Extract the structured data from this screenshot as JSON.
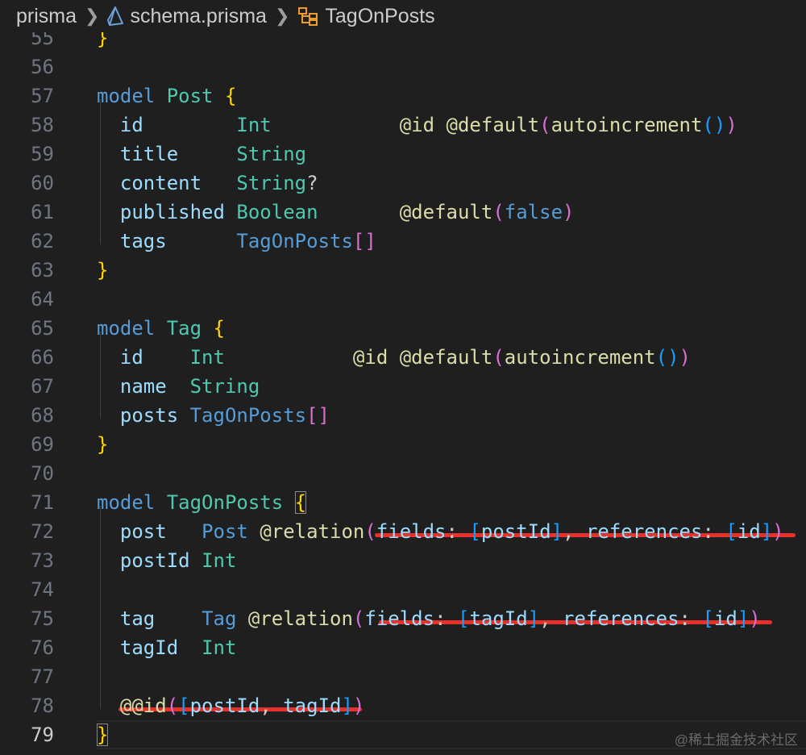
{
  "breadcrumb": {
    "folder": "prisma",
    "file": "schema.prisma",
    "symbol": "TagOnPosts"
  },
  "lines": [
    {
      "num": "55",
      "tokens": [
        {
          "t": "}",
          "c": "b1"
        }
      ]
    },
    {
      "num": "56",
      "tokens": []
    },
    {
      "num": "57",
      "tokens": [
        {
          "t": "model",
          "c": "kw"
        },
        {
          "t": " "
        },
        {
          "t": "Post",
          "c": "mn"
        },
        {
          "t": " "
        },
        {
          "t": "{",
          "c": "b1"
        }
      ]
    },
    {
      "num": "58",
      "tokens": [
        {
          "t": "  "
        },
        {
          "t": "id",
          "c": "fd"
        },
        {
          "t": "        "
        },
        {
          "t": "Int",
          "c": "ty"
        },
        {
          "t": "           "
        },
        {
          "t": "@id",
          "c": "at"
        },
        {
          "t": " "
        },
        {
          "t": "@default",
          "c": "at"
        },
        {
          "t": "(",
          "c": "b2"
        },
        {
          "t": "autoincrement",
          "c": "at"
        },
        {
          "t": "()",
          "c": "b3"
        },
        {
          "t": ")",
          "c": "b2"
        }
      ]
    },
    {
      "num": "59",
      "tokens": [
        {
          "t": "  "
        },
        {
          "t": "title",
          "c": "fd"
        },
        {
          "t": "     "
        },
        {
          "t": "String",
          "c": "ty"
        }
      ]
    },
    {
      "num": "60",
      "tokens": [
        {
          "t": "  "
        },
        {
          "t": "content",
          "c": "fd"
        },
        {
          "t": "   "
        },
        {
          "t": "String",
          "c": "ty"
        },
        {
          "t": "?"
        }
      ]
    },
    {
      "num": "61",
      "tokens": [
        {
          "t": "  "
        },
        {
          "t": "published",
          "c": "fd"
        },
        {
          "t": " "
        },
        {
          "t": "Boolean",
          "c": "ty"
        },
        {
          "t": "       "
        },
        {
          "t": "@default",
          "c": "at"
        },
        {
          "t": "(",
          "c": "b2"
        },
        {
          "t": "false",
          "c": "mt"
        },
        {
          "t": ")",
          "c": "b2"
        }
      ]
    },
    {
      "num": "62",
      "tokens": [
        {
          "t": "  "
        },
        {
          "t": "tags",
          "c": "fd"
        },
        {
          "t": "      "
        },
        {
          "t": "TagOnPosts",
          "c": "mt"
        },
        {
          "t": "[]",
          "c": "b2"
        }
      ]
    },
    {
      "num": "63",
      "tokens": [
        {
          "t": "}",
          "c": "b1"
        }
      ]
    },
    {
      "num": "64",
      "tokens": []
    },
    {
      "num": "65",
      "tokens": [
        {
          "t": "model",
          "c": "kw"
        },
        {
          "t": " "
        },
        {
          "t": "Tag",
          "c": "mn"
        },
        {
          "t": " "
        },
        {
          "t": "{",
          "c": "b1"
        }
      ]
    },
    {
      "num": "66",
      "tokens": [
        {
          "t": "  "
        },
        {
          "t": "id",
          "c": "fd"
        },
        {
          "t": "    "
        },
        {
          "t": "Int",
          "c": "ty"
        },
        {
          "t": "           "
        },
        {
          "t": "@id",
          "c": "at"
        },
        {
          "t": " "
        },
        {
          "t": "@default",
          "c": "at"
        },
        {
          "t": "(",
          "c": "b2"
        },
        {
          "t": "autoincrement",
          "c": "at"
        },
        {
          "t": "()",
          "c": "b3"
        },
        {
          "t": ")",
          "c": "b2"
        }
      ]
    },
    {
      "num": "67",
      "tokens": [
        {
          "t": "  "
        },
        {
          "t": "name",
          "c": "fd"
        },
        {
          "t": "  "
        },
        {
          "t": "String",
          "c": "ty"
        }
      ]
    },
    {
      "num": "68",
      "tokens": [
        {
          "t": "  "
        },
        {
          "t": "posts",
          "c": "fd"
        },
        {
          "t": " "
        },
        {
          "t": "TagOnPosts",
          "c": "mt"
        },
        {
          "t": "[]",
          "c": "b2"
        }
      ]
    },
    {
      "num": "69",
      "tokens": [
        {
          "t": "}",
          "c": "b1"
        }
      ]
    },
    {
      "num": "70",
      "tokens": []
    },
    {
      "num": "71",
      "tokens": [
        {
          "t": "model",
          "c": "kw"
        },
        {
          "t": " "
        },
        {
          "t": "TagOnPosts",
          "c": "mn"
        },
        {
          "t": " "
        },
        {
          "t": "{",
          "c": "b1 bxm"
        }
      ]
    },
    {
      "num": "72",
      "tokens": [
        {
          "t": "  "
        },
        {
          "t": "post",
          "c": "fd"
        },
        {
          "t": "   "
        },
        {
          "t": "Post",
          "c": "mt"
        },
        {
          "t": " "
        },
        {
          "t": "@relation",
          "c": "at"
        },
        {
          "t": "(",
          "c": "b2"
        },
        {
          "t": "fields",
          "c": "fd"
        },
        {
          "t": ": "
        },
        {
          "t": "[",
          "c": "b3"
        },
        {
          "t": "postId",
          "c": "fd"
        },
        {
          "t": "]",
          "c": "b3"
        },
        {
          "t": ", "
        },
        {
          "t": "references",
          "c": "fd"
        },
        {
          "t": ": "
        },
        {
          "t": "[",
          "c": "b3"
        },
        {
          "t": "id",
          "c": "fd"
        },
        {
          "t": "]",
          "c": "b3"
        },
        {
          "t": ")",
          "c": "b2"
        }
      ]
    },
    {
      "num": "73",
      "tokens": [
        {
          "t": "  "
        },
        {
          "t": "postId",
          "c": "fd"
        },
        {
          "t": " "
        },
        {
          "t": "Int",
          "c": "ty"
        }
      ]
    },
    {
      "num": "74",
      "tokens": []
    },
    {
      "num": "75",
      "tokens": [
        {
          "t": "  "
        },
        {
          "t": "tag",
          "c": "fd"
        },
        {
          "t": "    "
        },
        {
          "t": "Tag",
          "c": "mt"
        },
        {
          "t": " "
        },
        {
          "t": "@relation",
          "c": "at"
        },
        {
          "t": "(",
          "c": "b2"
        },
        {
          "t": "fields",
          "c": "fd"
        },
        {
          "t": ": "
        },
        {
          "t": "[",
          "c": "b3"
        },
        {
          "t": "tagId",
          "c": "fd"
        },
        {
          "t": "]",
          "c": "b3"
        },
        {
          "t": ", "
        },
        {
          "t": "references",
          "c": "fd"
        },
        {
          "t": ": "
        },
        {
          "t": "[",
          "c": "b3"
        },
        {
          "t": "id",
          "c": "fd"
        },
        {
          "t": "]",
          "c": "b3"
        },
        {
          "t": ")",
          "c": "b2"
        }
      ]
    },
    {
      "num": "76",
      "tokens": [
        {
          "t": "  "
        },
        {
          "t": "tagId",
          "c": "fd"
        },
        {
          "t": "  "
        },
        {
          "t": "Int",
          "c": "ty"
        }
      ]
    },
    {
      "num": "77",
      "tokens": []
    },
    {
      "num": "78",
      "tokens": [
        {
          "t": "  "
        },
        {
          "t": "@@id",
          "c": "at"
        },
        {
          "t": "(",
          "c": "b2"
        },
        {
          "t": "[",
          "c": "b3"
        },
        {
          "t": "postId",
          "c": "fd"
        },
        {
          "t": ", "
        },
        {
          "t": "tagId",
          "c": "fd"
        },
        {
          "t": "]",
          "c": "b3"
        },
        {
          "t": ")",
          "c": "b2"
        }
      ]
    },
    {
      "num": "79",
      "active": true,
      "tokens": [
        {
          "t": "}",
          "c": "b1 bxm"
        }
      ]
    }
  ],
  "watermark": "@稀土掘金技术社区",
  "colors": {
    "background": "#1f1f1f",
    "underline": "#e8312a"
  }
}
